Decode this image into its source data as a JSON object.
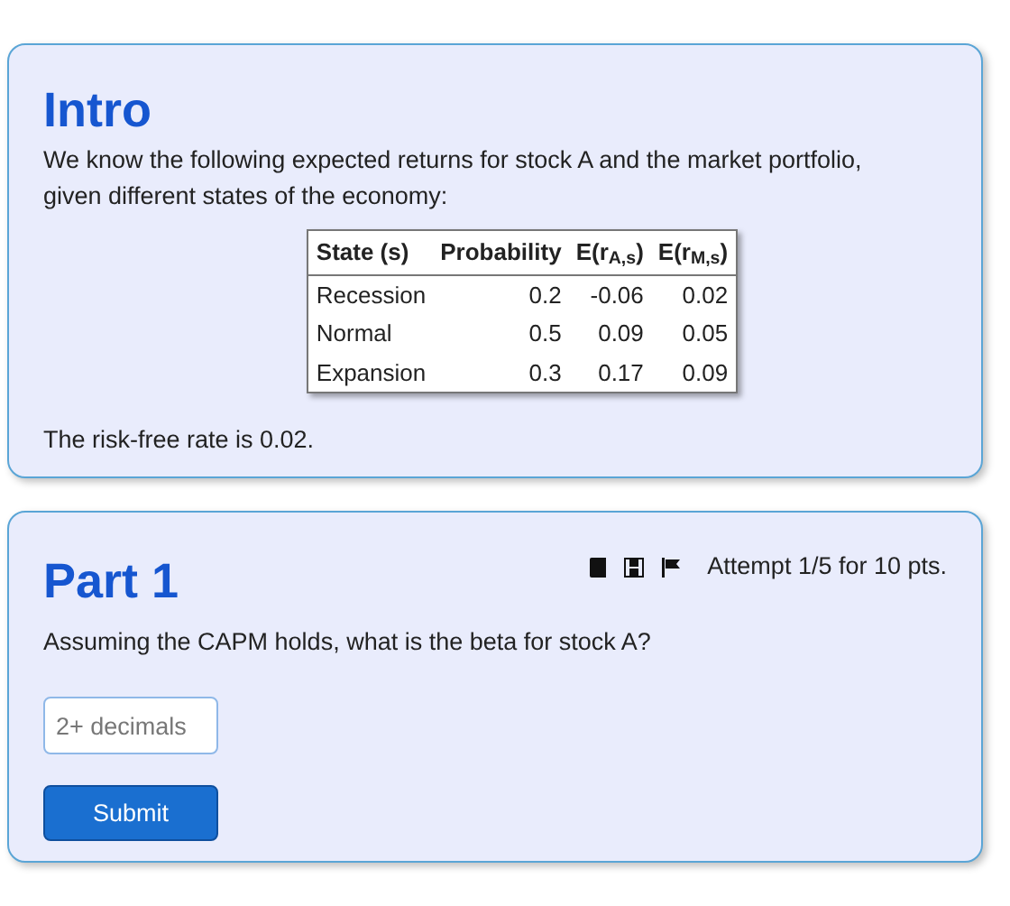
{
  "intro": {
    "title": "Intro",
    "text": "We know the following expected returns for stock A and the market portfolio, given different states of the economy:",
    "table": {
      "columns": [
        "State (s)",
        "Probability",
        "E(r$_{A,s}$)",
        "E(r$_{M,s}$)"
      ],
      "rows": [
        [
          "Recession",
          "0.2",
          "-0.06",
          "0.02"
        ],
        [
          "Normal",
          "0.5",
          "0.09",
          "0.05"
        ],
        [
          "Expansion",
          "0.3",
          "0.17",
          "0.09"
        ]
      ]
    },
    "note": "The risk-free rate is 0.02."
  },
  "part": {
    "title": "Part 1",
    "attempt": "Attempt 1/5 for 10 pts.",
    "question": "Assuming the CAPM holds, what is the beta for stock A?",
    "answer": {
      "placeholder": "2+ decimals"
    },
    "submit": "Submit"
  }
}
